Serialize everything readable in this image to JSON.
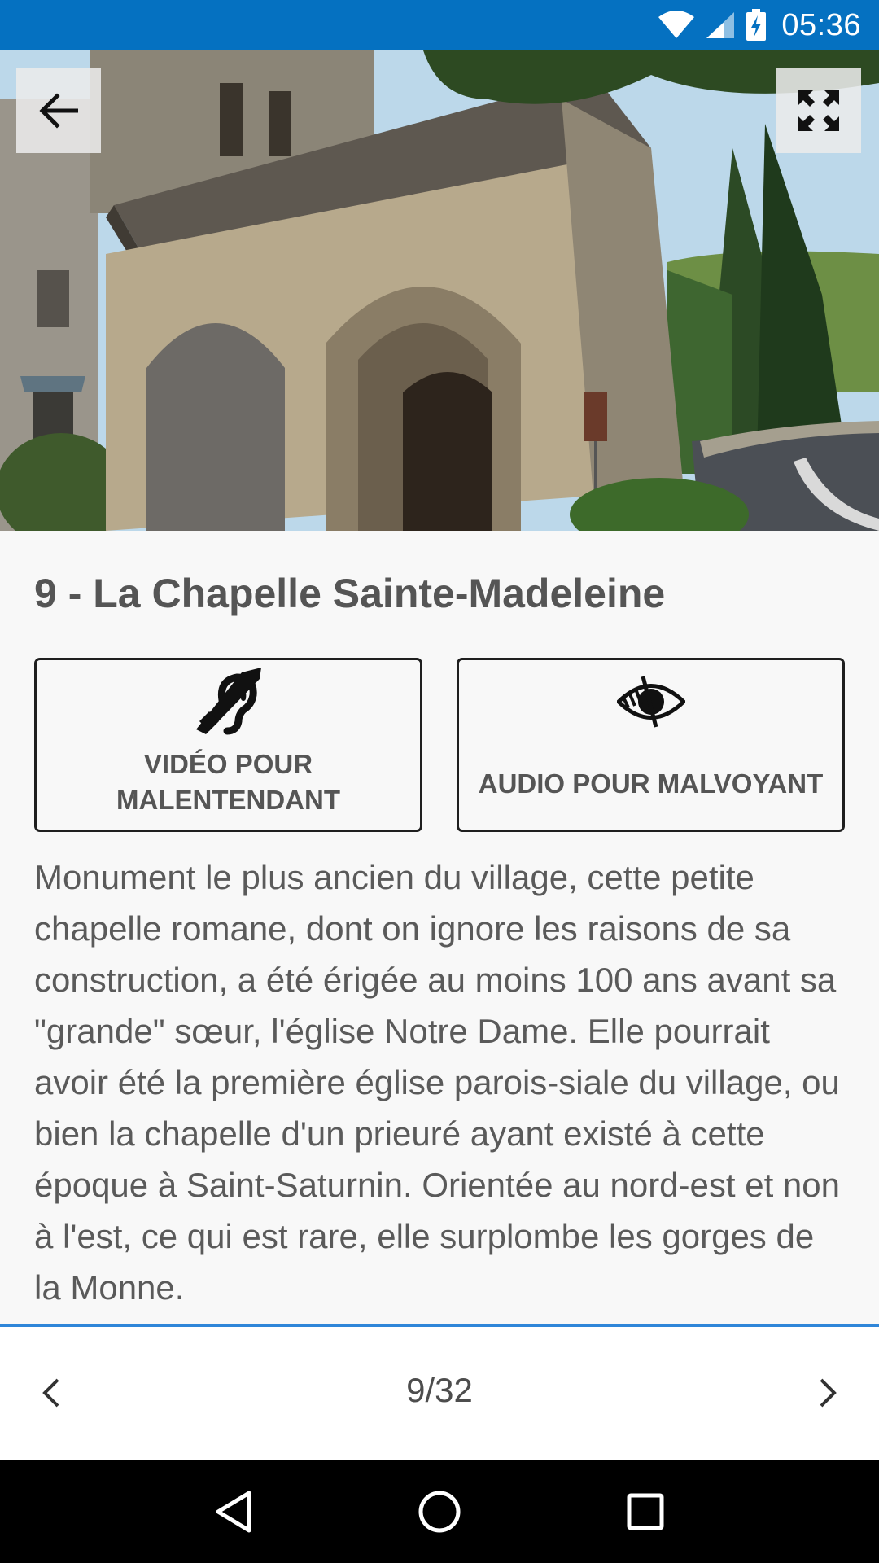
{
  "status_bar": {
    "time": "05:36",
    "icons": [
      "wifi-icon",
      "signal-icon",
      "battery-charging-icon"
    ]
  },
  "hero": {
    "back_icon": "arrow-back-icon",
    "fullscreen_icon": "fullscreen-icon"
  },
  "title": "9 - La Chapelle Sainte-Madeleine",
  "access_buttons": [
    {
      "icon": "hearing-impaired-icon",
      "label_line1": "VIDÉO POUR",
      "label_line2": "MALENTENDANT"
    },
    {
      "icon": "visually-impaired-icon",
      "label": "AUDIO POUR MALVOYANT"
    }
  ],
  "description": "Monument le plus ancien du village, cette petite chapelle romane, dont on ignore les raisons de sa construction, a été érigée au moins 100 ans avant sa \"grande\" sœur, l'église Notre Dame. Elle pourrait avoir été la première église parois-siale du village, ou bien la chapelle d'un prieuré ayant existé à cette époque à Saint-Saturnin. Orientée au nord-est et non à l'est, ce qui est rare, elle surplombe les gorges de la Monne.",
  "pager": {
    "current": "9/32",
    "prev_icon": "chevron-left-icon",
    "next_icon": "chevron-right-icon"
  },
  "system_nav": [
    "back-triangle-icon",
    "home-circle-icon",
    "recents-square-icon"
  ],
  "colors": {
    "status_bar": "#0571c1",
    "pager_border": "#2f86d9",
    "text": "#555555"
  }
}
